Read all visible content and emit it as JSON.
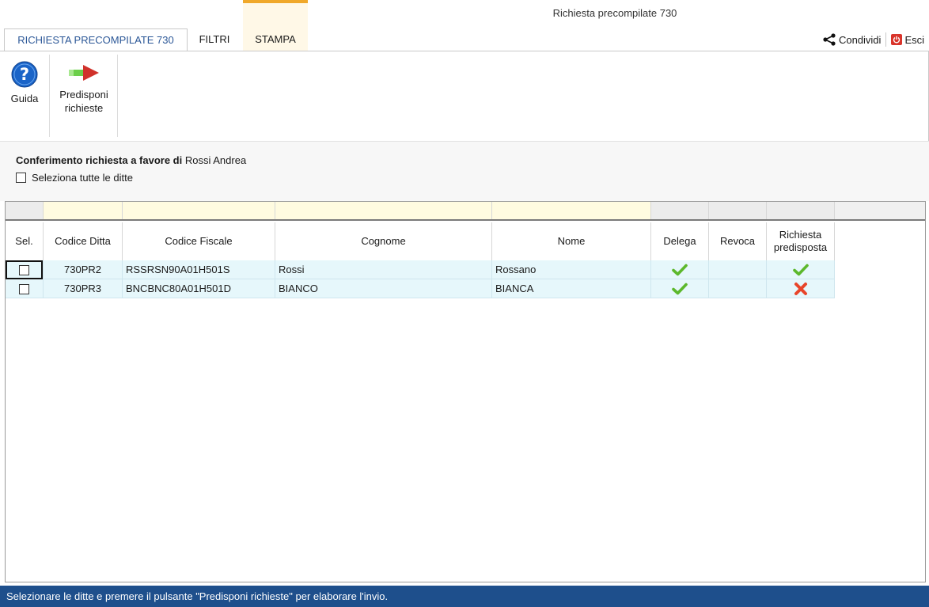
{
  "window": {
    "title": "Richiesta precompilate 730"
  },
  "tabs": [
    {
      "label": "RICHIESTA PRECOMPILATE 730",
      "active": true
    },
    {
      "label": "FILTRI",
      "active": false
    },
    {
      "label": "STAMPA",
      "active": false
    }
  ],
  "actions": {
    "share_label": "Condividi",
    "exit_label": "Esci"
  },
  "ribbon": {
    "guide_label": "Guida",
    "prepare_label_line1": "Predisponi",
    "prepare_label_line2": "richieste"
  },
  "confirm": {
    "prefix": "Conferimento richiesta a favore di",
    "person": "Rossi Andrea",
    "select_all_label": "Seleziona tutte le ditte"
  },
  "table": {
    "columns": [
      "Sel.",
      "Codice Ditta",
      "Codice Fiscale",
      "Cognome",
      "Nome",
      "Delega",
      "Revoca",
      "Richiesta predisposta"
    ],
    "column_last_line1": "Richiesta",
    "column_last_line2": "predisposta",
    "rows": [
      {
        "codice_ditta": "730PR2",
        "codice_fiscale": "RSSRSN90A01H501S",
        "cognome": "Rossi",
        "nome": "Rossano",
        "delega": "check-icon",
        "revoca": "",
        "richiesta_predisposta": "check-icon"
      },
      {
        "codice_ditta": "730PR3",
        "codice_fiscale": "BNCBNC80A01H501D",
        "cognome": "BIANCO",
        "nome": "BIANCA",
        "delega": "check-icon",
        "revoca": "",
        "richiesta_predisposta": "cross-icon"
      }
    ]
  },
  "status": {
    "message": "Selezionare le ditte e premere il pulsante \"Predisponi richieste\" per elaborare l'invio."
  },
  "colors": {
    "accent_tab": "#f0a82a",
    "status_bar": "#1e4f8c",
    "row_bg": "#e6f7fb",
    "check": "#5cb82c",
    "cross": "#e8452a",
    "help_blue": "#1a64c8"
  }
}
